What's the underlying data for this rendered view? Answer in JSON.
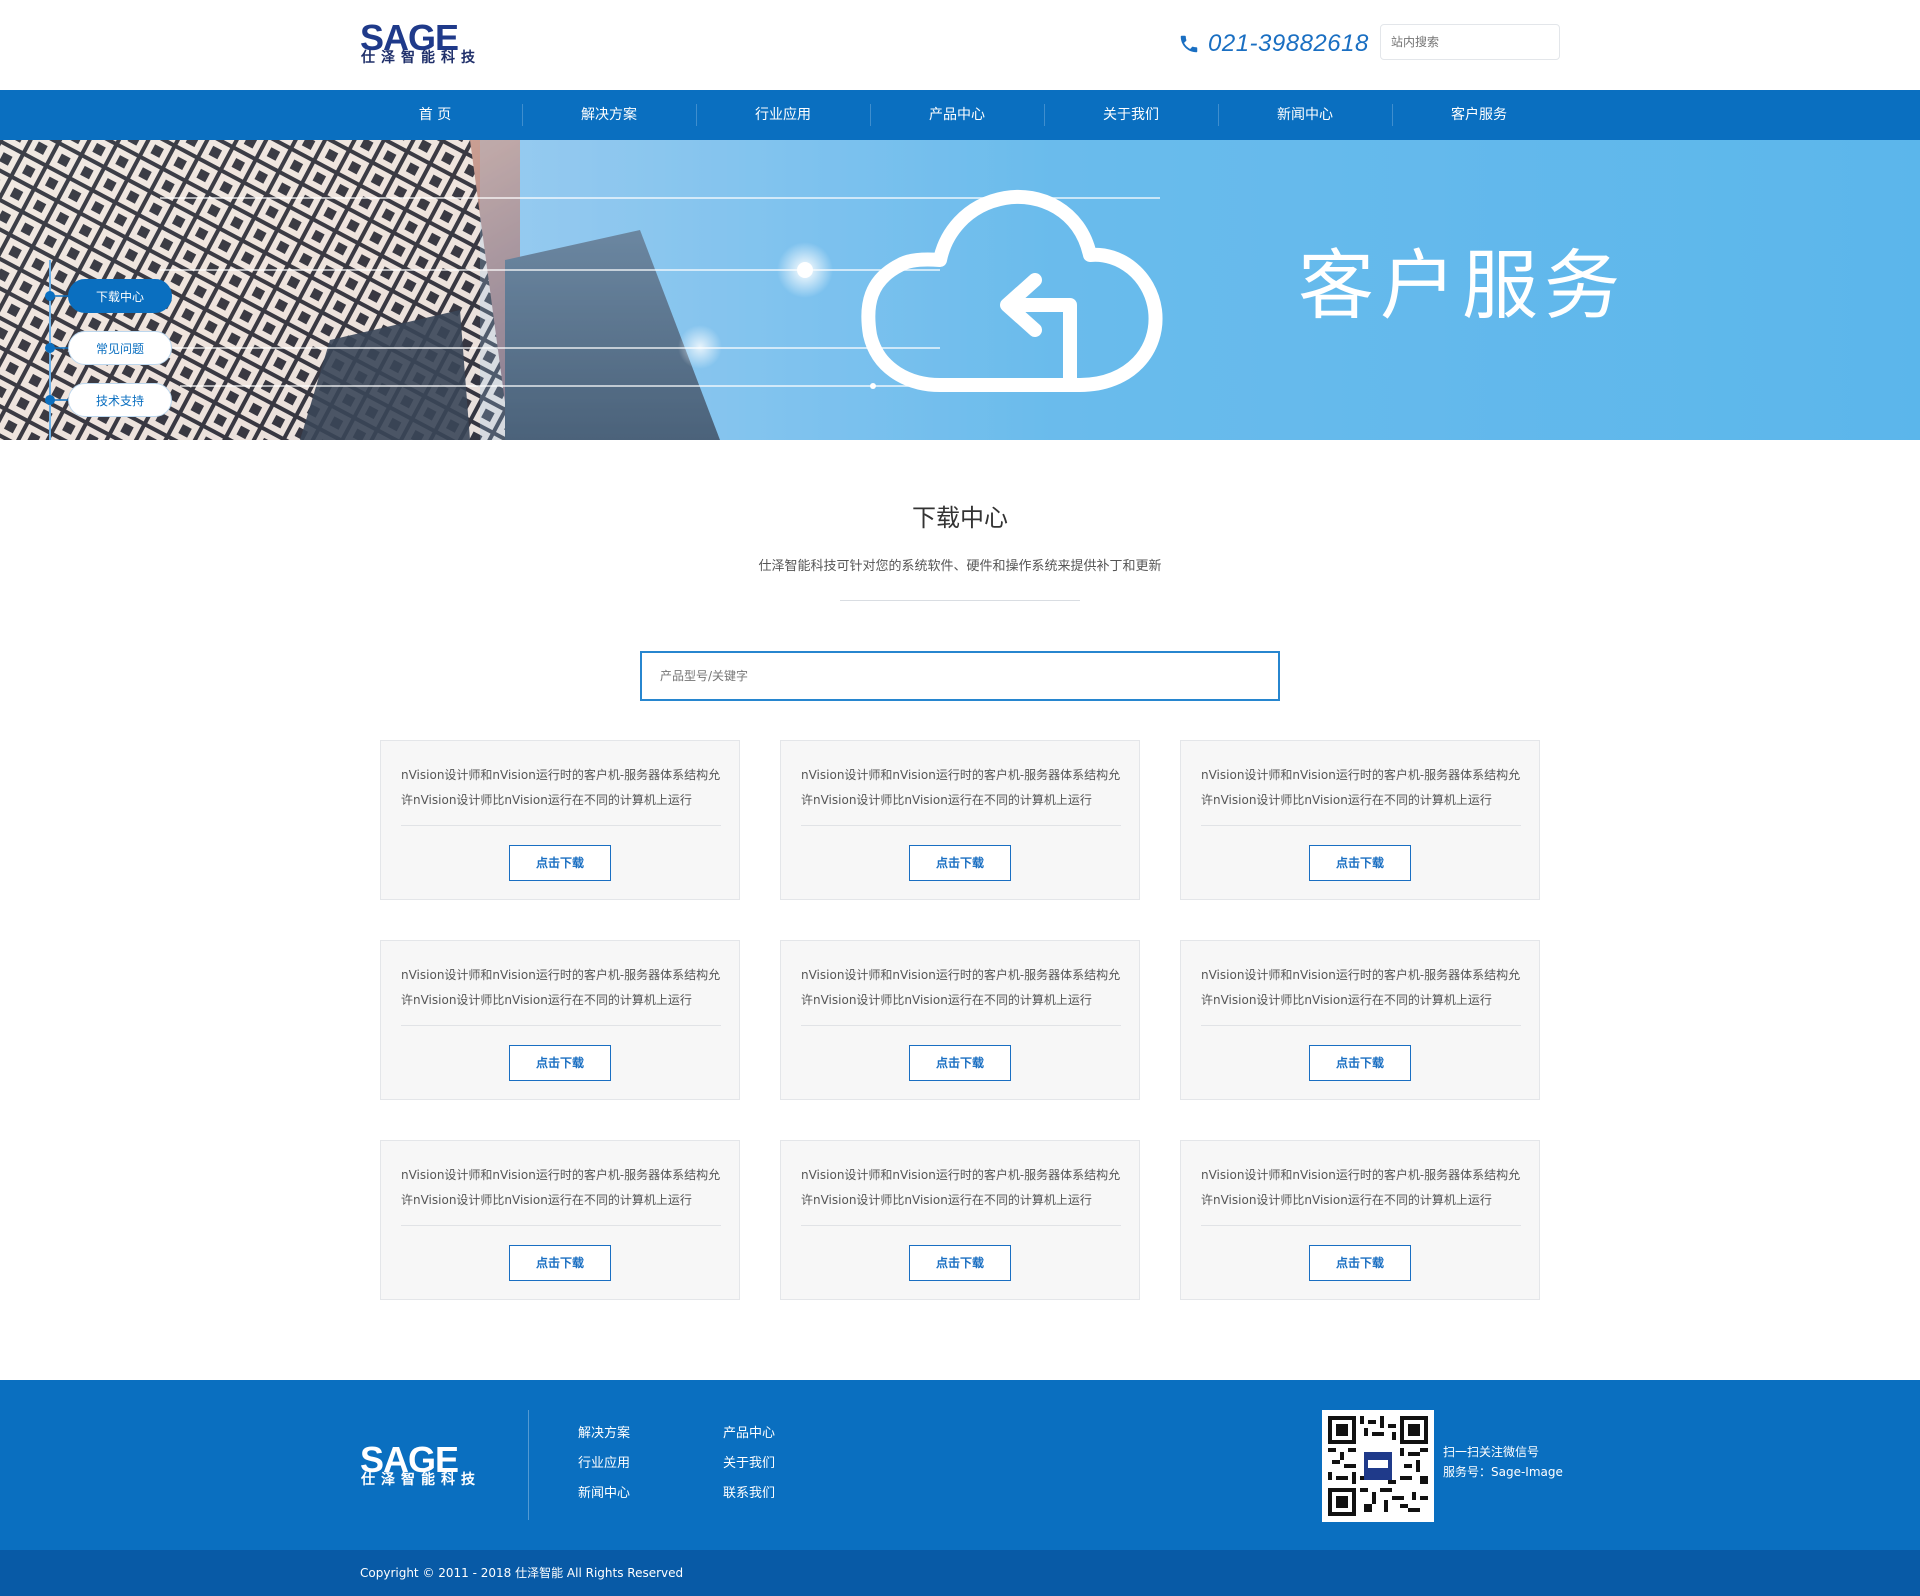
{
  "header": {
    "logo_text": "SAGE",
    "logo_subtitle": "仕泽智能科技",
    "phone": "021-39882618",
    "search_placeholder": "站内搜索"
  },
  "nav": {
    "items": [
      "首 页",
      "解决方案",
      "行业应用",
      "产品中心",
      "关于我们",
      "新闻中心",
      "客户服务"
    ]
  },
  "banner": {
    "title": "客户服务",
    "side_menu": [
      "下载中心",
      "常见问题",
      "技术支持"
    ],
    "active_index": 0
  },
  "section": {
    "title": "下载中心",
    "subtitle": "仕泽智能科技可针对您的系统软件、硬件和操作系统来提供补丁和更新",
    "search_placeholder": "产品型号/关键字"
  },
  "cards": [
    {
      "desc": "nVision设计师和nVision运行时的客户机-服务器体系结构允许nVision设计师比nVision运行在不同的计算机上运行",
      "button": "点击下载"
    },
    {
      "desc": "nVision设计师和nVision运行时的客户机-服务器体系结构允许nVision设计师比nVision运行在不同的计算机上运行",
      "button": "点击下载"
    },
    {
      "desc": "nVision设计师和nVision运行时的客户机-服务器体系结构允许nVision设计师比nVision运行在不同的计算机上运行",
      "button": "点击下载"
    },
    {
      "desc": "nVision设计师和nVision运行时的客户机-服务器体系结构允许nVision设计师比nVision运行在不同的计算机上运行",
      "button": "点击下载"
    },
    {
      "desc": "nVision设计师和nVision运行时的客户机-服务器体系结构允许nVision设计师比nVision运行在不同的计算机上运行",
      "button": "点击下载"
    },
    {
      "desc": "nVision设计师和nVision运行时的客户机-服务器体系结构允许nVision设计师比nVision运行在不同的计算机上运行",
      "button": "点击下载"
    },
    {
      "desc": "nVision设计师和nVision运行时的客户机-服务器体系结构允许nVision设计师比nVision运行在不同的计算机上运行",
      "button": "点击下载"
    },
    {
      "desc": "nVision设计师和nVision运行时的客户机-服务器体系结构允许nVision设计师比nVision运行在不同的计算机上运行",
      "button": "点击下载"
    },
    {
      "desc": "nVision设计师和nVision运行时的客户机-服务器体系结构允许nVision设计师比nVision运行在不同的计算机上运行",
      "button": "点击下载"
    }
  ],
  "footer": {
    "logo_text": "SAGE",
    "logo_subtitle": "仕泽智能科技",
    "links": [
      "解决方案",
      "产品中心",
      "行业应用",
      "关于我们",
      "新闻中心",
      "联系我们"
    ],
    "qr_caption_1": "扫一扫关注微信号",
    "qr_caption_2": "服务号：Sage-Image",
    "copyright": "Copyright © 2011 - 2018 仕泽智能 All Rights Reserved"
  },
  "colors": {
    "brand_blue": "#0a6fc0",
    "accent_blue": "#1a6fc2",
    "banner_sky": "#45aee9"
  },
  "icons": {
    "phone": "phone-icon",
    "cloud": "cloud-upload-icon",
    "qr": "qr-code-icon"
  }
}
